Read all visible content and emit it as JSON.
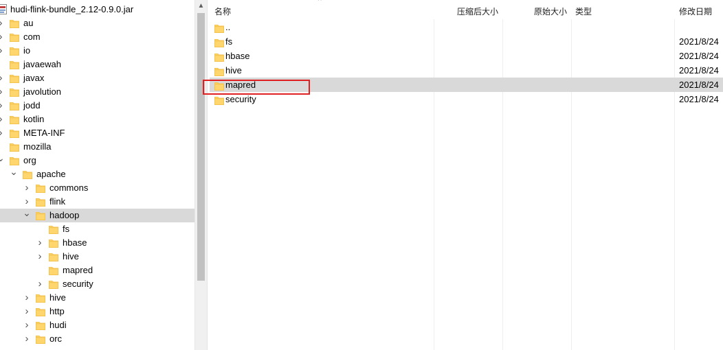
{
  "tree": {
    "root": {
      "label": "hudi-flink-bundle_2.12-0.9.0.jar",
      "icon": "jar-file-icon"
    },
    "items": [
      {
        "label": "au",
        "depth": 0,
        "chevron": "right",
        "selected": false
      },
      {
        "label": "com",
        "depth": 0,
        "chevron": "right",
        "selected": false
      },
      {
        "label": "io",
        "depth": 0,
        "chevron": "right",
        "selected": false
      },
      {
        "label": "javaewah",
        "depth": 0,
        "chevron": "none",
        "selected": false
      },
      {
        "label": "javax",
        "depth": 0,
        "chevron": "right",
        "selected": false
      },
      {
        "label": "javolution",
        "depth": 0,
        "chevron": "right",
        "selected": false
      },
      {
        "label": "jodd",
        "depth": 0,
        "chevron": "right",
        "selected": false
      },
      {
        "label": "kotlin",
        "depth": 0,
        "chevron": "right",
        "selected": false
      },
      {
        "label": "META-INF",
        "depth": 0,
        "chevron": "right",
        "selected": false
      },
      {
        "label": "mozilla",
        "depth": 0,
        "chevron": "none",
        "selected": false
      },
      {
        "label": "org",
        "depth": 0,
        "chevron": "down",
        "selected": false
      },
      {
        "label": "apache",
        "depth": 1,
        "chevron": "down",
        "selected": false
      },
      {
        "label": "commons",
        "depth": 2,
        "chevron": "right",
        "selected": false
      },
      {
        "label": "flink",
        "depth": 2,
        "chevron": "right",
        "selected": false
      },
      {
        "label": "hadoop",
        "depth": 2,
        "chevron": "down",
        "selected": true
      },
      {
        "label": "fs",
        "depth": 3,
        "chevron": "none",
        "selected": false
      },
      {
        "label": "hbase",
        "depth": 3,
        "chevron": "right",
        "selected": false
      },
      {
        "label": "hive",
        "depth": 3,
        "chevron": "right",
        "selected": false
      },
      {
        "label": "mapred",
        "depth": 3,
        "chevron": "none",
        "selected": false
      },
      {
        "label": "security",
        "depth": 3,
        "chevron": "right",
        "selected": false
      },
      {
        "label": "hive",
        "depth": 2,
        "chevron": "right",
        "selected": false
      },
      {
        "label": "http",
        "depth": 2,
        "chevron": "right",
        "selected": false
      },
      {
        "label": "hudi",
        "depth": 2,
        "chevron": "right",
        "selected": false
      },
      {
        "label": "orc",
        "depth": 2,
        "chevron": "right",
        "selected": false
      }
    ]
  },
  "list": {
    "columns": {
      "name": "名称",
      "compressed_size": "压缩后大小",
      "original_size": "原始大小",
      "type": "类型",
      "modified": "修改日期"
    },
    "sort_indicator": "^",
    "rows": [
      {
        "name": "..",
        "date": "",
        "selected": false
      },
      {
        "name": "fs",
        "date": "2021/8/24",
        "selected": false
      },
      {
        "name": "hbase",
        "date": "2021/8/24",
        "selected": false
      },
      {
        "name": "hive",
        "date": "2021/8/24",
        "selected": false
      },
      {
        "name": "mapred",
        "date": "2021/8/24",
        "selected": true
      },
      {
        "name": "security",
        "date": "2021/8/24",
        "selected": false
      }
    ]
  },
  "colors": {
    "folder_fill": "#ffd66e",
    "folder_tab": "#f4c24e",
    "selection": "#d9d9d9",
    "highlight_box": "#e02020"
  }
}
